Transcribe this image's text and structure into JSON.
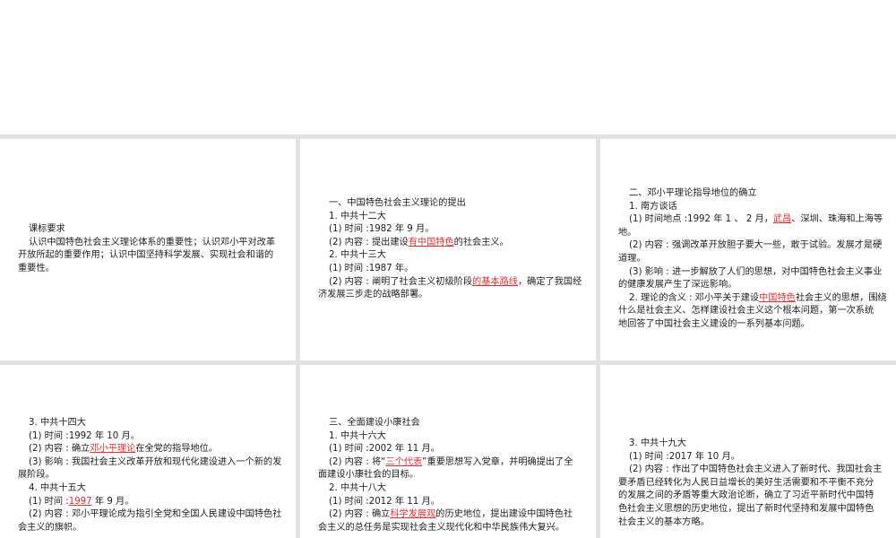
{
  "panels": [
    {
      "id": "standards",
      "lines": [
        {
          "indent": true,
          "parts": [
            {
              "t": "课标要求"
            }
          ]
        },
        {
          "indent": true,
          "parts": [
            {
              "t": "认识中国特色社会主义理论体系的重要性；认识邓小平对改革"
            }
          ]
        },
        {
          "indent": false,
          "parts": [
            {
              "t": "开放所起的重要作用；认识中国坚持科学发展、实现社会和谐的"
            }
          ]
        },
        {
          "indent": false,
          "parts": [
            {
              "t": "重要性。"
            }
          ]
        }
      ]
    },
    {
      "id": "section-1",
      "lines": [
        {
          "indent": true,
          "parts": [
            {
              "t": "一、中国特色社会主义理论的提出"
            }
          ]
        },
        {
          "indent": true,
          "parts": [
            {
              "t": "1. 中共十二大"
            }
          ]
        },
        {
          "indent": true,
          "parts": [
            {
              "t": "(1) 时间 :1982 年 9 月。"
            }
          ]
        },
        {
          "indent": true,
          "parts": [
            {
              "t": "(2) 内容 : 提出建设"
            },
            {
              "t": "有中国特色",
              "red": true
            },
            {
              "t": "的社会主义。"
            }
          ]
        },
        {
          "indent": true,
          "parts": [
            {
              "t": "2. 中共十三大"
            }
          ]
        },
        {
          "indent": true,
          "parts": [
            {
              "t": "(1) 时间 :1987 年。"
            }
          ]
        },
        {
          "indent": true,
          "parts": [
            {
              "t": "(2) 内容 : 阐明了社会主义初级阶段"
            },
            {
              "t": "的基本路线",
              "red": true
            },
            {
              "t": "，确定了我国经"
            }
          ]
        },
        {
          "indent": false,
          "parts": [
            {
              "t": "济发展三步走的战略部署。"
            }
          ]
        }
      ]
    },
    {
      "id": "section-2",
      "lines": [
        {
          "indent": true,
          "parts": [
            {
              "t": "二、邓小平理论指导地位的确立"
            }
          ]
        },
        {
          "indent": true,
          "parts": [
            {
              "t": "1. 南方谈话"
            }
          ]
        },
        {
          "indent": true,
          "parts": [
            {
              "t": "(1) 时间地点 :1992 年 1 、 2 月，"
            },
            {
              "t": "武昌",
              "red": true
            },
            {
              "t": "、深圳、珠海和上海等"
            }
          ]
        },
        {
          "indent": false,
          "parts": [
            {
              "t": "地。"
            }
          ]
        },
        {
          "indent": true,
          "parts": [
            {
              "t": "(2) 内容 : 强调改革开放胆子要大一些，敢于试验。发展才是硬"
            }
          ]
        },
        {
          "indent": false,
          "parts": [
            {
              "t": "道理。"
            }
          ]
        },
        {
          "indent": true,
          "parts": [
            {
              "t": "(3) 影响 : 进一步解放了人们的思想，对中国特色社会主义事业"
            }
          ]
        },
        {
          "indent": false,
          "parts": [
            {
              "t": "的健康发展产生了深远影响。"
            }
          ]
        },
        {
          "indent": true,
          "parts": [
            {
              "t": "2. 理论的含义 : 邓小平关于建设"
            },
            {
              "t": "中国特色",
              "red": true
            },
            {
              "t": "社会主义的思想，围绕"
            }
          ]
        },
        {
          "indent": false,
          "parts": [
            {
              "t": "什么是社会主义、怎样建设社会主义这个根本问题，第一次系统"
            }
          ]
        },
        {
          "indent": false,
          "parts": [
            {
              "t": "地回答了中国社会主义建设的一系列基本问题。"
            }
          ]
        }
      ]
    },
    {
      "id": "section-2-cont",
      "lines": [
        {
          "indent": true,
          "parts": [
            {
              "t": "3. 中共十四大"
            }
          ]
        },
        {
          "indent": true,
          "parts": [
            {
              "t": "(1) 时间 :1992 年 10 月。"
            }
          ]
        },
        {
          "indent": true,
          "parts": [
            {
              "t": "(2) 内容 : 确立"
            },
            {
              "t": "邓小平理论",
              "red": true
            },
            {
              "t": "在全党的指导地位。"
            }
          ]
        },
        {
          "indent": true,
          "parts": [
            {
              "t": "(3) 影响 : 我国社会主义改革开放和现代化建设进入一个新的发"
            }
          ]
        },
        {
          "indent": false,
          "parts": [
            {
              "t": "展阶段。"
            }
          ]
        },
        {
          "indent": true,
          "parts": [
            {
              "t": "4. 中共十五大"
            }
          ]
        },
        {
          "indent": true,
          "parts": [
            {
              "t": "(1) 时间 :"
            },
            {
              "t": "1997",
              "red": true
            },
            {
              "t": " 年 9 月。"
            }
          ]
        },
        {
          "indent": true,
          "parts": [
            {
              "t": "(2) 内容 : 邓小平理论成为指引全党和全国人民建设中国特色社"
            }
          ]
        },
        {
          "indent": false,
          "parts": [
            {
              "t": "会主义的旗帜。"
            }
          ]
        }
      ]
    },
    {
      "id": "section-3",
      "lines": [
        {
          "indent": true,
          "parts": [
            {
              "t": "三、全面建设小康社会"
            }
          ]
        },
        {
          "indent": true,
          "parts": [
            {
              "t": "1. 中共十六大"
            }
          ]
        },
        {
          "indent": true,
          "parts": [
            {
              "t": "(1) 时间 :2002 年 11 月。"
            }
          ]
        },
        {
          "indent": true,
          "parts": [
            {
              "t": "(2) 内容 : 将“"
            },
            {
              "t": "三个代表",
              "red": true
            },
            {
              "t": "”重要思想写入党章，并明确提出了全"
            }
          ]
        },
        {
          "indent": false,
          "parts": [
            {
              "t": "面建设小康社会的目标。"
            }
          ]
        },
        {
          "indent": true,
          "parts": [
            {
              "t": "2. 中共十八大"
            }
          ]
        },
        {
          "indent": true,
          "parts": [
            {
              "t": "(1) 时间 :2012 年 11 月。"
            }
          ]
        },
        {
          "indent": true,
          "parts": [
            {
              "t": "(2) 内容 : 确立"
            },
            {
              "t": "科学发展观",
              "red": true
            },
            {
              "t": "的历史地位，提出建设中国特色社"
            }
          ]
        },
        {
          "indent": false,
          "parts": [
            {
              "t": "会主义的总任务是实现社会主义现代化和中华民族伟大复兴。"
            }
          ]
        }
      ]
    },
    {
      "id": "section-3-cont",
      "lines": [
        {
          "indent": true,
          "parts": [
            {
              "t": "3. 中共十九大"
            }
          ]
        },
        {
          "indent": true,
          "parts": [
            {
              "t": "(1) 时间 :2017 年 10 月。"
            }
          ]
        },
        {
          "indent": true,
          "parts": [
            {
              "t": "(2) 内容 : 作出了中国特色社会主义进入了新时代、我国社会主"
            }
          ]
        },
        {
          "indent": false,
          "parts": [
            {
              "t": "要矛盾已经转化为人民日益增长的美好生活需要和不平衡不充分"
            }
          ]
        },
        {
          "indent": false,
          "parts": [
            {
              "t": "的发展之间的矛盾等重大政治论断，确立了习近平新时代中国特"
            }
          ]
        },
        {
          "indent": false,
          "parts": [
            {
              "t": "色社会主义思想的历史地位，提出了新时代坚持和发展中国特色"
            }
          ]
        },
        {
          "indent": false,
          "parts": [
            {
              "t": "社会主义的基本方略。"
            }
          ]
        }
      ]
    }
  ]
}
